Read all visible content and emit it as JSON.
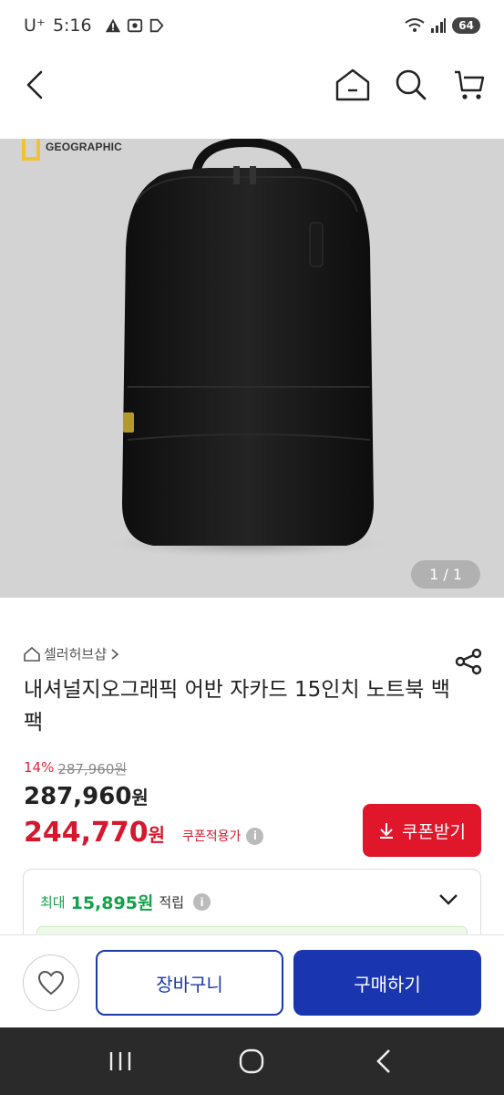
{
  "status": {
    "carrier": "U⁺",
    "time": "5:16",
    "battery": "64"
  },
  "header": {
    "back_icon": "chevron-left-icon",
    "home_icon": "home-icon",
    "search_icon": "search-icon",
    "cart_icon": "cart-icon"
  },
  "image": {
    "brand_logo_text": "GEOGRAPHIC",
    "counter": "1 / 1"
  },
  "product": {
    "seller": "셀러허브샵",
    "title": "내셔널지오그래픽 어반 자카드 15인치 노트북 백팩",
    "discount_rate": "14%",
    "original_price": "287,960원",
    "price_value": "287,960",
    "price_unit": "원",
    "sale_price_value": "244,770",
    "sale_price_unit": "원",
    "coupon_label": "쿠폰적용가",
    "coupon_button": "쿠폰받기"
  },
  "points": {
    "prefix": "최대",
    "amount": "15,895원",
    "suffix": "적립"
  },
  "actions": {
    "cart": "장바구니",
    "buy": "구매하기"
  },
  "colors": {
    "accent_red": "#e0162b",
    "accent_blue": "#1a35b0",
    "points_green": "#14a14a"
  }
}
